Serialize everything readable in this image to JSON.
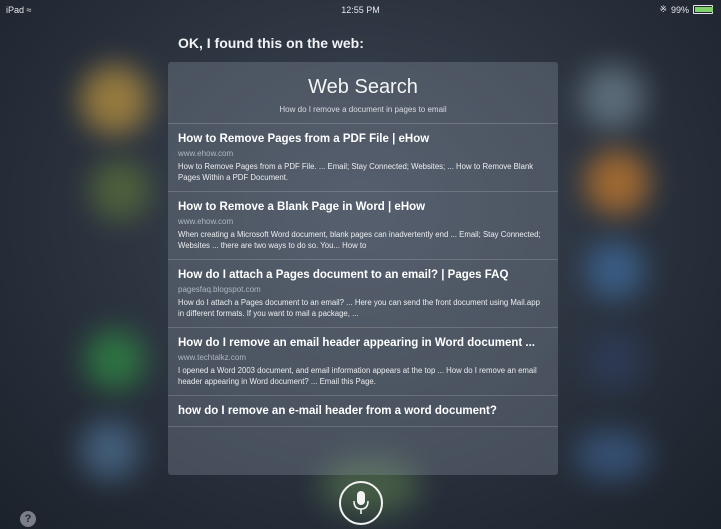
{
  "status_bar": {
    "device": "iPad",
    "time": "12:55 PM",
    "battery": "99%",
    "battery_level": 0.99
  },
  "siri": {
    "heading": "OK, I found this on the web:"
  },
  "card": {
    "title": "Web Search",
    "query": "How do I remove a document in pages to email",
    "results": [
      {
        "title": "How to Remove Pages from a PDF File | eHow",
        "url": "www.ehow.com",
        "desc": "How to Remove Pages from a PDF File. ... Email; Stay Connected; Websites; ... How to Remove Blank Pages Within a PDF Document."
      },
      {
        "title": "How to Remove a Blank Page in Word | eHow",
        "url": "www.ehow.com",
        "desc": "When creating a Microsoft Word document, blank pages can inadvertently end ... Email; Stay Connected; Websites ... there are two ways to do so. You... How to"
      },
      {
        "title": "How do I attach a Pages document to an email? | Pages FAQ",
        "url": "pagesfaq.blogspot.com",
        "desc": "How do I attach a Pages document to an email? ... Here you can send the front document using Mail.app in different formats. If you want to mail a package, ..."
      },
      {
        "title": "How do I remove an email header appearing in Word document ...",
        "url": "www.techtalkz.com",
        "desc": "I opened a Word 2003 document, and email information appears at the top ... How do I remove an email header appearing in Word document? ... Email this Page."
      },
      {
        "title": "how do I remove an e-mail header from a word document?",
        "url": "",
        "desc": ""
      }
    ]
  },
  "icons": {
    "mic": "microphone-icon",
    "help": "question-mark-icon",
    "wifi": "wifi-icon",
    "bluetooth": "bluetooth-icon",
    "battery": "battery-icon"
  },
  "help_label": "?"
}
